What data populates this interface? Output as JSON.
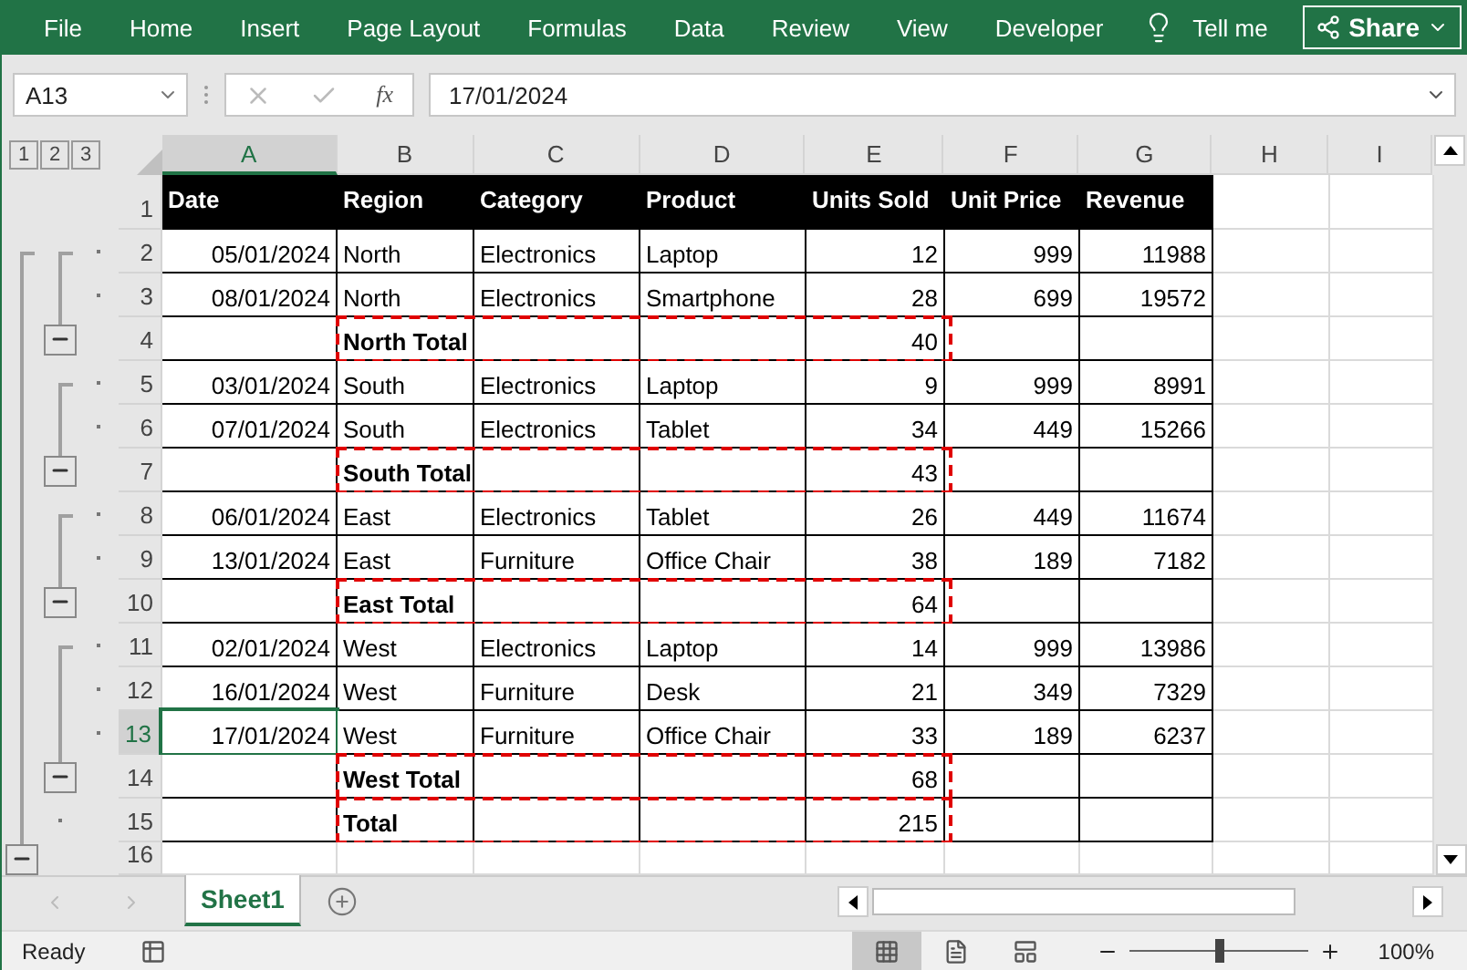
{
  "ribbon": {
    "tabs": [
      "File",
      "Home",
      "Insert",
      "Page Layout",
      "Formulas",
      "Data",
      "Review",
      "View",
      "Developer"
    ],
    "tell_me": "Tell me",
    "share": "Share"
  },
  "formula_bar": {
    "name_box": "A13",
    "function_label": "fx",
    "value": "17/01/2024"
  },
  "outline_levels": [
    "1",
    "2",
    "3"
  ],
  "columns": [
    {
      "label": "A",
      "selected": true
    },
    {
      "label": "B",
      "selected": false
    },
    {
      "label": "C",
      "selected": false
    },
    {
      "label": "D",
      "selected": false
    },
    {
      "label": "E",
      "selected": false
    },
    {
      "label": "F",
      "selected": false
    },
    {
      "label": "G",
      "selected": false
    },
    {
      "label": "H",
      "selected": false
    },
    {
      "label": "I",
      "selected": false
    }
  ],
  "rows": [
    {
      "number": "1",
      "kind": "header",
      "selected": false,
      "outline": [
        {
          "kind": "none"
        },
        {
          "kind": "none"
        },
        {
          "kind": "none"
        }
      ],
      "cells": [
        "Date",
        "Region",
        "Category",
        "Product",
        "Units Sold",
        "Unit Price",
        "Revenue"
      ]
    },
    {
      "number": "2",
      "kind": "data",
      "selected": false,
      "outline": [
        {
          "kind": "start"
        },
        {
          "kind": "start"
        },
        {
          "kind": "dot"
        }
      ],
      "cells": [
        "05/01/2024",
        "North",
        "Electronics",
        "Laptop",
        "12",
        "999",
        "11988"
      ]
    },
    {
      "number": "3",
      "kind": "data",
      "selected": false,
      "outline": [
        {
          "kind": "line"
        },
        {
          "kind": "line"
        },
        {
          "kind": "dot"
        }
      ],
      "cells": [
        "08/01/2024",
        "North",
        "Electronics",
        "Smartphone",
        "28",
        "699",
        "19572"
      ]
    },
    {
      "number": "4",
      "kind": "total",
      "selected": false,
      "outline": [
        {
          "kind": "line"
        },
        {
          "kind": "minus"
        },
        {
          "kind": "none"
        }
      ],
      "cells": [
        null,
        "North Total",
        null,
        null,
        "40",
        null,
        null
      ]
    },
    {
      "number": "5",
      "kind": "data",
      "selected": false,
      "outline": [
        {
          "kind": "line"
        },
        {
          "kind": "start"
        },
        {
          "kind": "dot"
        }
      ],
      "cells": [
        "03/01/2024",
        "South",
        "Electronics",
        "Laptop",
        "9",
        "999",
        "8991"
      ]
    },
    {
      "number": "6",
      "kind": "data",
      "selected": false,
      "outline": [
        {
          "kind": "line"
        },
        {
          "kind": "line"
        },
        {
          "kind": "dot"
        }
      ],
      "cells": [
        "07/01/2024",
        "South",
        "Electronics",
        "Tablet",
        "34",
        "449",
        "15266"
      ]
    },
    {
      "number": "7",
      "kind": "total",
      "selected": false,
      "outline": [
        {
          "kind": "line"
        },
        {
          "kind": "minus"
        },
        {
          "kind": "none"
        }
      ],
      "cells": [
        null,
        "South Total",
        null,
        null,
        "43",
        null,
        null
      ]
    },
    {
      "number": "8",
      "kind": "data",
      "selected": false,
      "outline": [
        {
          "kind": "line"
        },
        {
          "kind": "start"
        },
        {
          "kind": "dot"
        }
      ],
      "cells": [
        "06/01/2024",
        "East",
        "Electronics",
        "Tablet",
        "26",
        "449",
        "11674"
      ]
    },
    {
      "number": "9",
      "kind": "data",
      "selected": false,
      "outline": [
        {
          "kind": "line"
        },
        {
          "kind": "line"
        },
        {
          "kind": "dot"
        }
      ],
      "cells": [
        "13/01/2024",
        "East",
        "Furniture",
        "Office Chair",
        "38",
        "189",
        "7182"
      ]
    },
    {
      "number": "10",
      "kind": "total",
      "selected": false,
      "outline": [
        {
          "kind": "line"
        },
        {
          "kind": "minus"
        },
        {
          "kind": "none"
        }
      ],
      "cells": [
        null,
        "East Total",
        null,
        null,
        "64",
        null,
        null
      ]
    },
    {
      "number": "11",
      "kind": "data",
      "selected": false,
      "outline": [
        {
          "kind": "line"
        },
        {
          "kind": "start"
        },
        {
          "kind": "dot"
        }
      ],
      "cells": [
        "02/01/2024",
        "West",
        "Electronics",
        "Laptop",
        "14",
        "999",
        "13986"
      ]
    },
    {
      "number": "12",
      "kind": "data",
      "selected": false,
      "outline": [
        {
          "kind": "line"
        },
        {
          "kind": "line"
        },
        {
          "kind": "dot"
        }
      ],
      "cells": [
        "16/01/2024",
        "West",
        "Furniture",
        "Desk",
        "21",
        "349",
        "7329"
      ]
    },
    {
      "number": "13",
      "kind": "data",
      "selected": true,
      "outline": [
        {
          "kind": "line"
        },
        {
          "kind": "line"
        },
        {
          "kind": "dot"
        }
      ],
      "cells": [
        "17/01/2024",
        "West",
        "Furniture",
        "Office Chair",
        "33",
        "189",
        "6237"
      ]
    },
    {
      "number": "14",
      "kind": "total",
      "selected": false,
      "outline": [
        {
          "kind": "line"
        },
        {
          "kind": "minus"
        },
        {
          "kind": "none"
        }
      ],
      "cells": [
        null,
        "West Total",
        null,
        null,
        "68",
        null,
        null
      ]
    },
    {
      "number": "15",
      "kind": "total",
      "selected": false,
      "outline": [
        {
          "kind": "line"
        },
        {
          "kind": "dot"
        },
        {
          "kind": "none"
        }
      ],
      "cells": [
        null,
        "Total",
        null,
        null,
        "215",
        null,
        null
      ]
    },
    {
      "number": "16",
      "kind": "empty",
      "selected": false,
      "outline": [
        {
          "kind": "minus"
        },
        {
          "kind": "none"
        },
        {
          "kind": "none"
        }
      ],
      "cells": [
        null,
        null,
        null,
        null,
        null,
        null,
        null
      ]
    }
  ],
  "sheet_tabs": [
    {
      "label": "Sheet1",
      "selected": true
    }
  ],
  "status": {
    "text": "Ready",
    "zoom": "100%",
    "zoom_slider": {
      "level": 0.5
    },
    "views": [
      {
        "kind": "normal",
        "selected": true
      },
      {
        "kind": "page-layout",
        "selected": false
      },
      {
        "kind": "page-break",
        "selected": false
      }
    ]
  }
}
